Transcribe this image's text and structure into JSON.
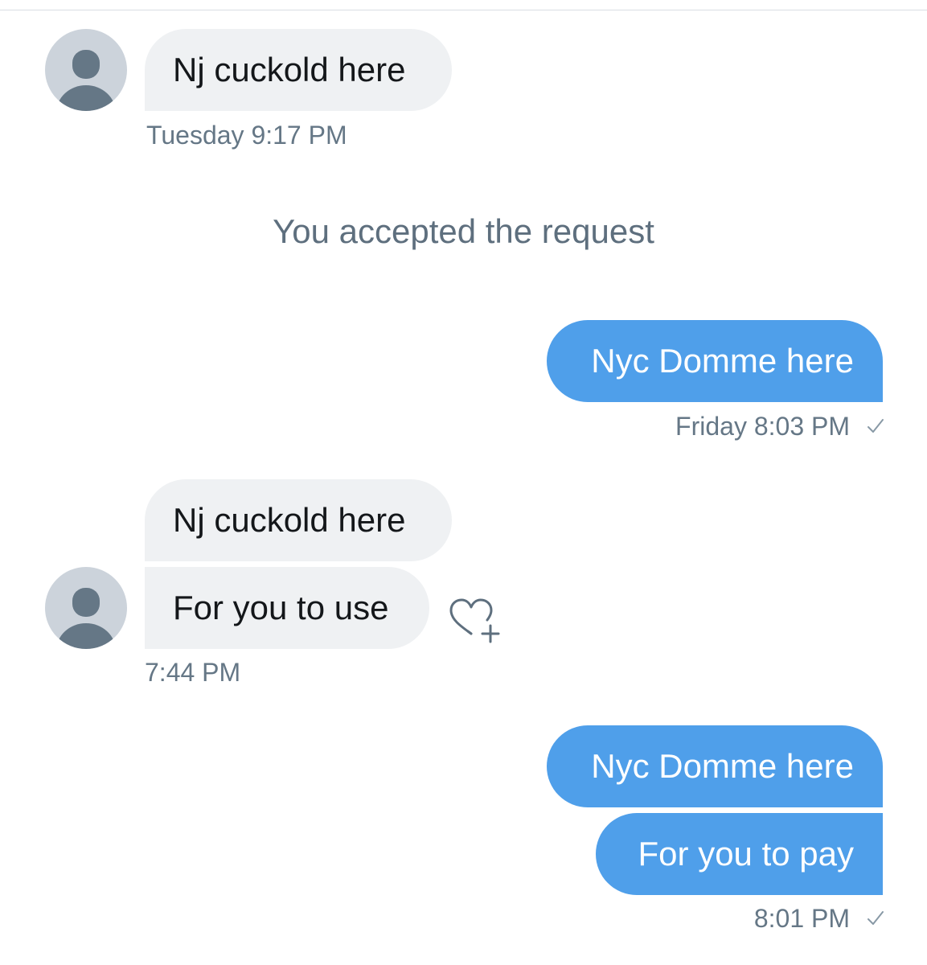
{
  "conversation": {
    "system_message": "You accepted the request",
    "messages": [
      {
        "sender": "other",
        "text": "Nj cuckold here",
        "timestamp": "Tuesday 9:17 PM"
      },
      {
        "sender": "me",
        "text": "Nyc Domme here",
        "timestamp": "Friday 8:03 PM",
        "status_icon": "check-icon"
      },
      {
        "sender": "other",
        "text": "Nj cuckold here"
      },
      {
        "sender": "other",
        "text": "For you to use",
        "timestamp": "7:44 PM",
        "reaction_button_icon": "heart-plus-icon"
      },
      {
        "sender": "me",
        "text": "Nyc Domme here"
      },
      {
        "sender": "me",
        "text": "For you to pay",
        "timestamp": "8:01 PM",
        "status_icon": "check-icon"
      }
    ]
  },
  "colors": {
    "outgoing_bubble": "#4f9fea",
    "incoming_bubble": "#eff1f3",
    "timestamp_text": "#657786",
    "avatar_placeholder": "#ccd3db"
  }
}
